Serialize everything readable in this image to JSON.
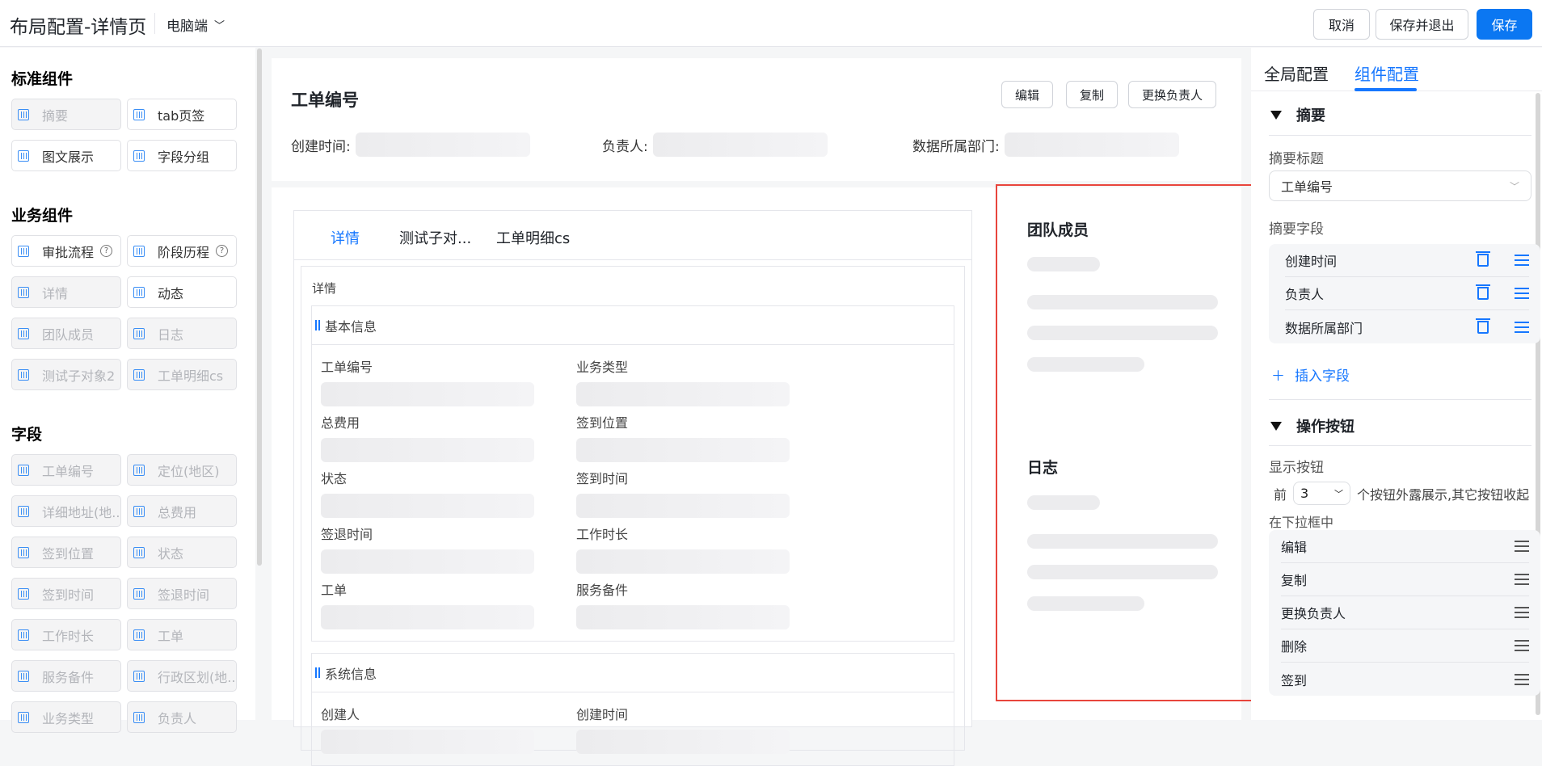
{
  "header": {
    "title": "布局配置-详情页",
    "device": "电脑端",
    "cancel": "取消",
    "save_exit": "保存并退出",
    "save": "保存"
  },
  "sidebar": {
    "sections": [
      {
        "title": "标准组件",
        "items": [
          {
            "label": "摘要",
            "disabled": true
          },
          {
            "label": "tab页签",
            "disabled": false
          },
          {
            "label": "图文展示",
            "disabled": false
          },
          {
            "label": "字段分组",
            "disabled": false
          }
        ]
      },
      {
        "title": "业务组件",
        "items": [
          {
            "label": "审批流程",
            "disabled": false,
            "help": true
          },
          {
            "label": "阶段历程",
            "disabled": false,
            "help": true
          },
          {
            "label": "详情",
            "disabled": true
          },
          {
            "label": "动态",
            "disabled": false
          },
          {
            "label": "团队成员",
            "disabled": true
          },
          {
            "label": "日志",
            "disabled": true
          },
          {
            "label": "测试子对象2",
            "disabled": true
          },
          {
            "label": "工单明细cs",
            "disabled": true
          }
        ]
      },
      {
        "title": "字段",
        "items": [
          {
            "label": "工单编号",
            "disabled": true
          },
          {
            "label": "定位(地区)",
            "disabled": true
          },
          {
            "label": "详细地址(地...",
            "disabled": true
          },
          {
            "label": "总费用",
            "disabled": true
          },
          {
            "label": "签到位置",
            "disabled": true
          },
          {
            "label": "状态",
            "disabled": true
          },
          {
            "label": "签到时间",
            "disabled": true
          },
          {
            "label": "签退时间",
            "disabled": true
          },
          {
            "label": "工作时长",
            "disabled": true
          },
          {
            "label": "工单",
            "disabled": true
          },
          {
            "label": "服务备件",
            "disabled": true
          },
          {
            "label": "行政区划(地...",
            "disabled": true
          },
          {
            "label": "业务类型",
            "disabled": true
          },
          {
            "label": "负责人",
            "disabled": true
          }
        ]
      }
    ]
  },
  "summary": {
    "title": "工单编号",
    "buttons": [
      "编辑",
      "复制",
      "更换负责人"
    ],
    "fields": [
      "创建时间:",
      "负责人:",
      "数据所属部门:"
    ]
  },
  "detail": {
    "tabs": [
      "详情",
      "测试子对...",
      "工单明细cs"
    ],
    "inner_title": "详情",
    "groups": [
      {
        "title": "基本信息",
        "fields": [
          "工单编号",
          "业务类型",
          "总费用",
          "签到位置",
          "状态",
          "签到时间",
          "签退时间",
          "工作时长",
          "工单",
          "服务备件"
        ]
      },
      {
        "title": "系统信息",
        "fields": [
          "创建人",
          "创建时间"
        ]
      }
    ]
  },
  "cards": {
    "team": "团队成员",
    "log": "日志"
  },
  "right": {
    "tabs": [
      "全局配置",
      "组件配置"
    ],
    "active_tab": 1,
    "summary_section": "摘要",
    "summary_title_label": "摘要标题",
    "summary_title_value": "工单编号",
    "summary_fields_label": "摘要字段",
    "summary_fields": [
      "创建时间",
      "负责人",
      "数据所属部门"
    ],
    "insert_field": "插入字段",
    "actions_section": "操作按钮",
    "show_buttons_label": "显示按钮",
    "prefix": "前",
    "count": "3",
    "suffix": "个按钮外露展示,其它按钮收起",
    "suffix2": "在下拉框中",
    "action_buttons": [
      "编辑",
      "复制",
      "更换负责人",
      "删除",
      "签到"
    ]
  },
  "colors": {
    "accent": "#1677ff",
    "highlight": "#e8453c"
  }
}
